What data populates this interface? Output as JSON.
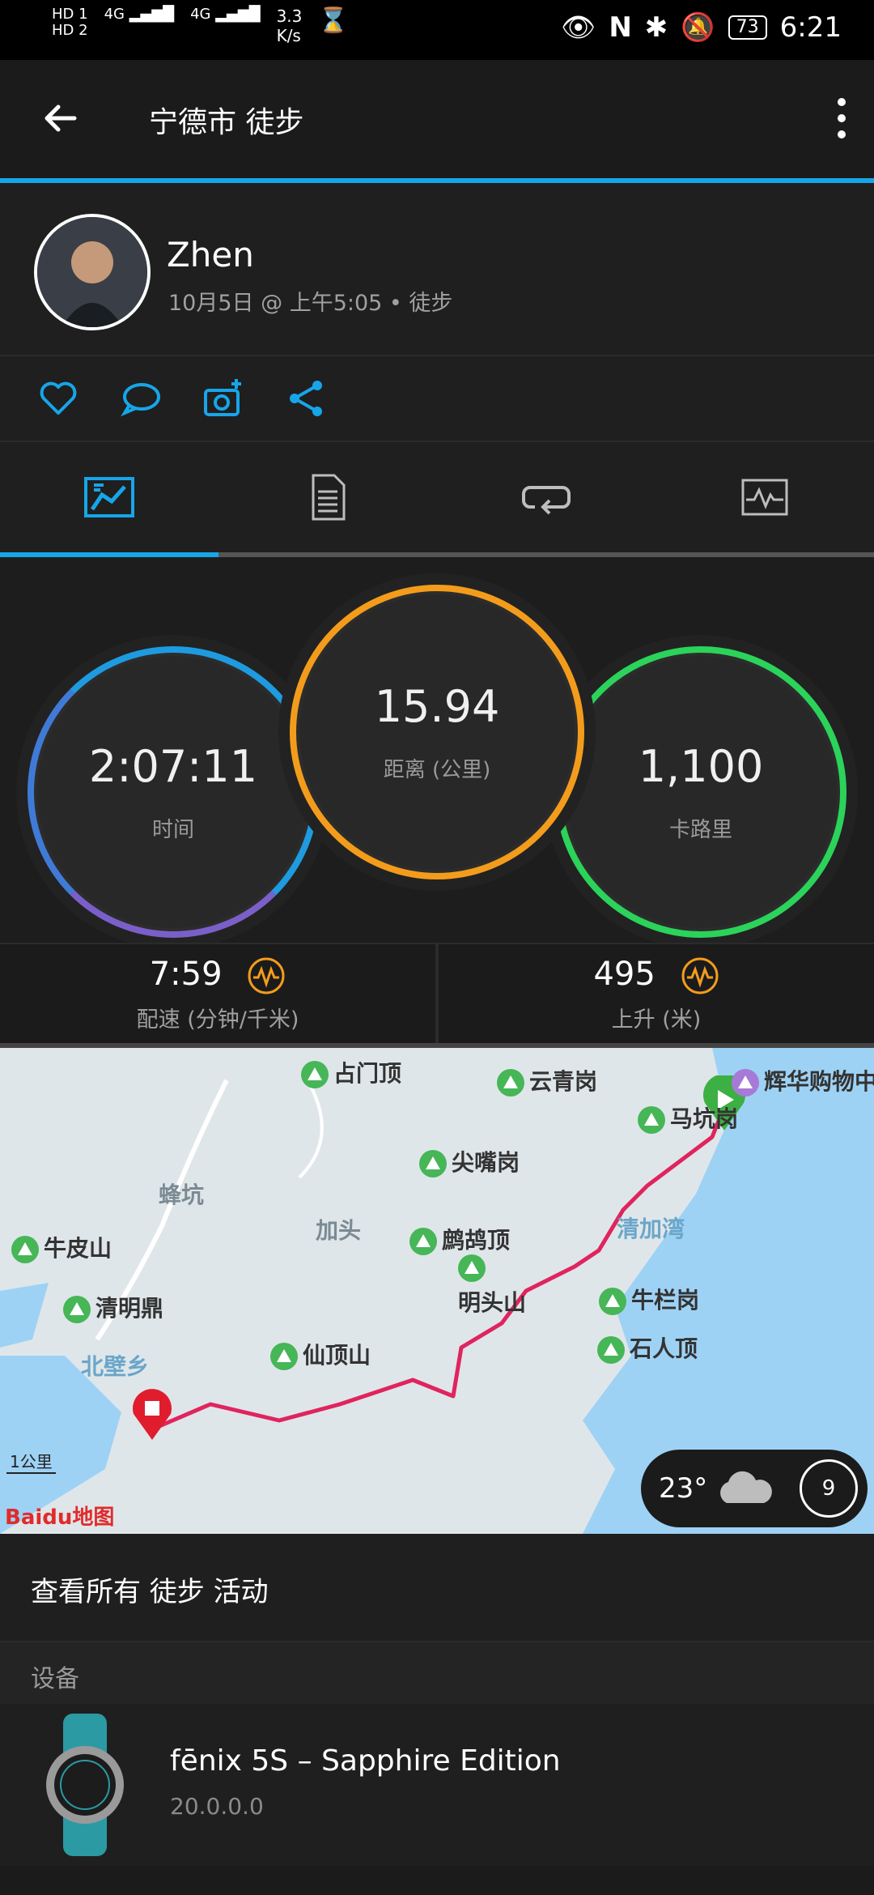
{
  "status_bar": {
    "hd1": "HD 1",
    "hd2": "HD 2",
    "net1": "4G",
    "net2": "4G",
    "speed_value": "3.3",
    "speed_unit": "K/s",
    "battery": "73",
    "time": "6:21"
  },
  "header": {
    "title": "宁德市 徒步"
  },
  "profile": {
    "name": "Zhen",
    "meta": "10月5日 @ 上午5:05 • 徒步"
  },
  "colors": {
    "accent": "#17a5e9",
    "ring_time_top": "#1e9be0",
    "ring_time_bottom": "#7b5fc9",
    "ring_distance": "#f39c1c",
    "ring_calories": "#2bd35a",
    "route": "#e0245e"
  },
  "stats": {
    "time": {
      "value": "2:07:11",
      "label": "时间"
    },
    "distance": {
      "value": "15.94",
      "label": "距离 (公里)"
    },
    "calories": {
      "value": "1,100",
      "label": "卡路里"
    }
  },
  "kpis": {
    "pace": {
      "value": "7:59",
      "label": "配速 (分钟/千米)"
    },
    "ascent": {
      "value": "495",
      "label": "上升 (米)"
    }
  },
  "map": {
    "pois": [
      "占门顶",
      "云青岗",
      "辉华购物中",
      "马坑岗",
      "尖嘴岗",
      "鹧鸪顶",
      "牛皮山",
      "明头山",
      "牛栏岗",
      "清明鼎",
      "仙顶山",
      "石人顶"
    ],
    "areas": [
      "蜂坑",
      "加头",
      "清加湾",
      "北壁乡"
    ],
    "scale": "1公里",
    "logo": "Baidu地图",
    "weather": {
      "temp": "23°",
      "wind": "9"
    }
  },
  "view_all": "查看所有 徒步 活动",
  "section_device": "设备",
  "device": {
    "name": "fēnix 5S – Sapphire Edition",
    "version": "20.0.0.0"
  }
}
